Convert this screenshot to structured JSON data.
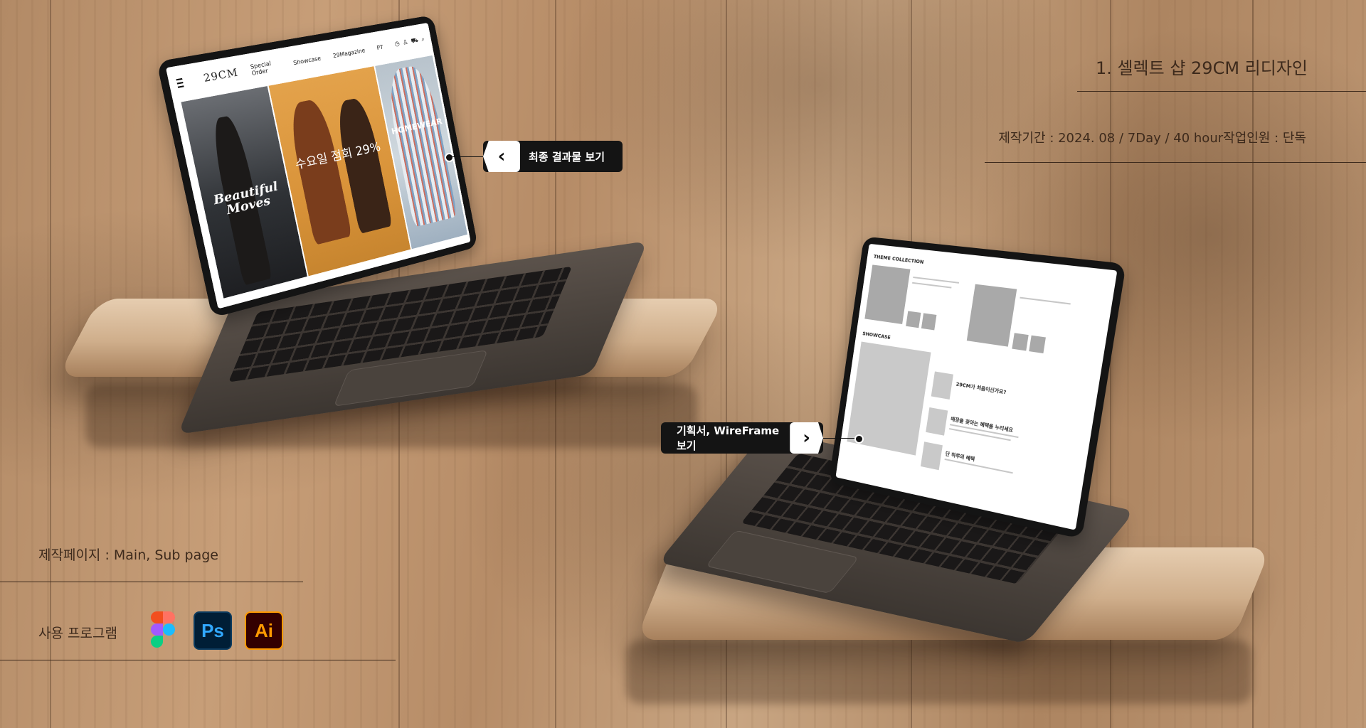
{
  "project": {
    "title": "1. 셀렉트 샵 29CM 리디자인",
    "meta": "제작기간 : 2024. 08 / 7Day / 40 hour작업인원 : 단독"
  },
  "callouts": {
    "final_result": "최종 결과물 보기",
    "wireframe": "기획서, WireFrame 보기"
  },
  "pages_info": "제작페이지 : Main, Sub page",
  "tools": {
    "label": "사용 프로그램",
    "ps_label": "Ps",
    "ai_label": "Ai",
    "ps_color": "#31a8ff",
    "ai_color": "#ff9a00"
  },
  "laptop1_site": {
    "logo": "29CM",
    "nav": [
      "Special Order",
      "Showcase",
      "29Magazine",
      "PT"
    ],
    "hero1_text": "Beautiful Moves",
    "hero2_text": "수요일 점회 29%",
    "hero3_text": "HOMEWEAR"
  },
  "laptop2_wireframe": {
    "section1": "THEME COLLECTION",
    "section2": "SHOWCASE",
    "item1": "29CM가 처음이신가요?",
    "item2": "매장을 찾아는 혜택을 누리세요",
    "item3": "단 하루의 혜택"
  },
  "colors": {
    "text_brown": "#3d2a1c",
    "callout_bg": "#141414"
  }
}
